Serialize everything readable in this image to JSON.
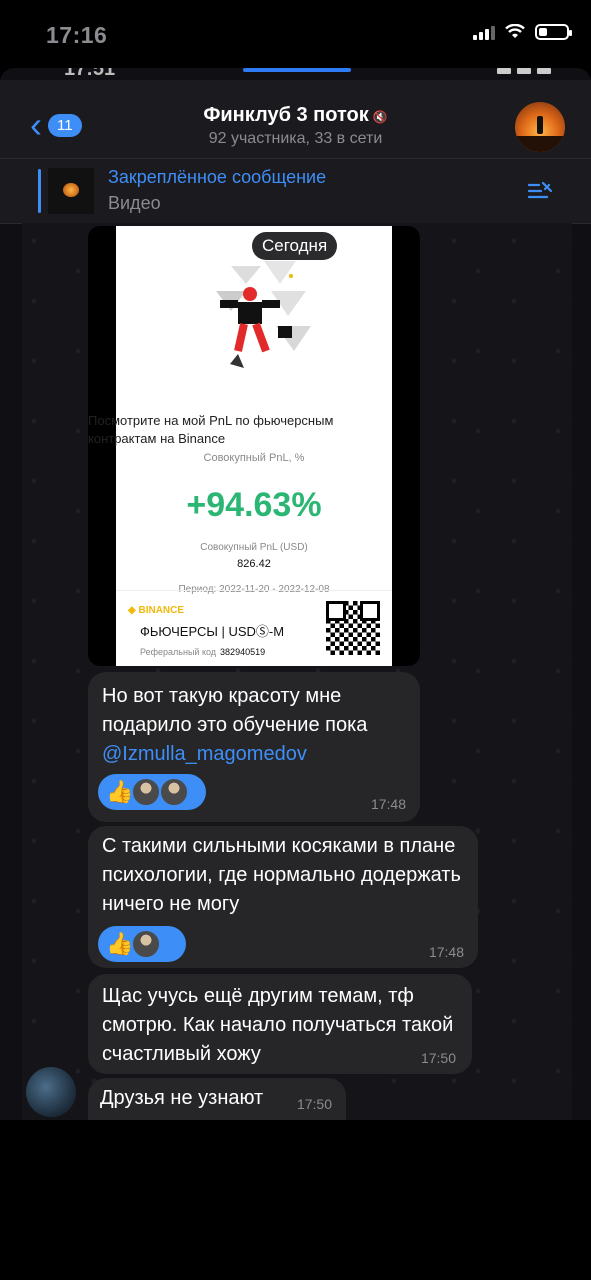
{
  "status_bar": {
    "time": "17:16"
  },
  "inner_status": {
    "time": "17:51"
  },
  "header": {
    "back_count": "11",
    "title": "Финклуб 3 поток",
    "subtitle": "92 участника, 33 в сети",
    "mute_icon": "mute-icon",
    "avatar_icon": "group-avatar"
  },
  "pinned": {
    "title": "Закреплённое сообщение",
    "text": "Видео"
  },
  "date_badge": "Сегодня",
  "screenshot_card": {
    "headline": "Посмотрите на мой PnL по фьючерсным контрактам на Binance",
    "pnl_label": "Совокупный PnL, %",
    "pnl_percent": "+94.63%",
    "pnl_usd_label": "Совокупный PnL (USD)",
    "pnl_usd_value": "826.42",
    "period": "Период: 2022-11-20 - 2022-12-08",
    "brand": "BINANCE",
    "product": "ФЬЮЧЕРСЫ | USDⓈ-M",
    "ref_label": "Реферальный код",
    "ref_code": "382940519"
  },
  "messages": [
    {
      "text": "Но вот такую красоту мне подарило это обучение пока",
      "mention": "@Izmulla_magomedov",
      "time": "17:48",
      "reaction": "👍"
    },
    {
      "text": "С такими сильными косяками в плане психологии, где нормально додержать ничего не могу",
      "time": "17:48",
      "reaction": "👍"
    },
    {
      "text": "Щас учусь ещё другим темам, тф смотрю. Как начало получаться такой счастливый хожу",
      "time": "17:50"
    },
    {
      "text": "Друзья не узнают",
      "time": "17:50"
    }
  ],
  "colors": {
    "accent": "#3e8ef7",
    "bubble": "#262628",
    "profit": "#2bb673"
  }
}
